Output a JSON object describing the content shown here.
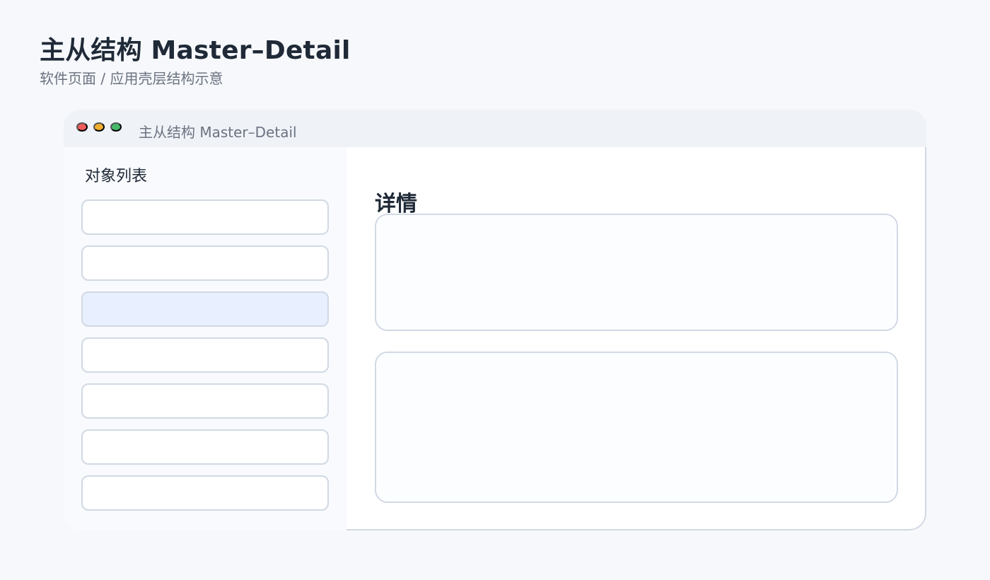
{
  "page": {
    "title": "主从结构 Master–Detail",
    "subtitle": "软件页面 / 应用壳层结构示意"
  },
  "window": {
    "title": "主从结构 Master–Detail",
    "controls": {
      "close_color": "#ef5b5b",
      "minimize_color": "#efae2e",
      "maximize_color": "#46b86a"
    }
  },
  "master": {
    "title": "对象列表",
    "selected_index": 2,
    "items": [
      {
        "selected": false
      },
      {
        "selected": false
      },
      {
        "selected": true
      },
      {
        "selected": false
      },
      {
        "selected": false
      },
      {
        "selected": false
      },
      {
        "selected": false
      }
    ]
  },
  "detail": {
    "title": "详情"
  },
  "colors": {
    "background": "#f6f8fb",
    "window_background": "#f8fafd",
    "titlebar": "#eff3f8",
    "border": "#d1d9e4",
    "selection": "#e8efff",
    "text_primary": "#1f2937",
    "text_secondary": "#6b7280"
  }
}
